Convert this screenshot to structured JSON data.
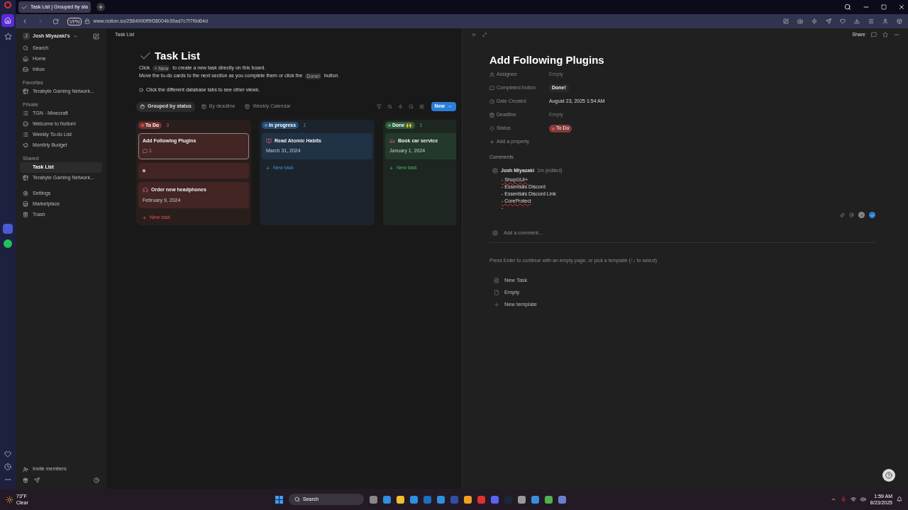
{
  "browser": {
    "tab_title": "Task List | Grouped by sta",
    "url": "www.notion.so/2584990ff9f38004b39ad7c7f7f9d64d",
    "vpn": "VPN"
  },
  "sidebar": {
    "workspace": "Josh Miyazaki's",
    "workspace_initial": "J",
    "top_items": [
      {
        "label": "Search"
      },
      {
        "label": "Home"
      },
      {
        "label": "Inbox"
      }
    ],
    "sections": [
      {
        "title": "Favorites",
        "items": [
          {
            "label": "Terabyte Gaming Network...",
            "selected": false
          }
        ]
      },
      {
        "title": "Private",
        "items": [
          {
            "label": "TGN - Minecraft",
            "selected": false
          },
          {
            "label": "Welcome to Notion!",
            "selected": false
          },
          {
            "label": "Weekly To-do List",
            "selected": false
          },
          {
            "label": "Monthly Budget",
            "selected": false
          }
        ]
      },
      {
        "title": "Shared",
        "items": [
          {
            "label": "Task List",
            "selected": true
          },
          {
            "label": "Terabyte Gaming Network...",
            "selected": false
          }
        ]
      }
    ],
    "bottom_items": [
      {
        "label": "Settings"
      },
      {
        "label": "Marketplace"
      },
      {
        "label": "Trash"
      }
    ],
    "invite": "Invite members"
  },
  "page": {
    "breadcrumb": "Task List",
    "title": "Task List",
    "desc_line_1": {
      "before": "Click",
      "chip": "+ New",
      "after": "to create a new task directly on this board."
    },
    "desc_line_2": {
      "before": "Move the to-do cards to the next section as you complete them or click the",
      "chip": "Done!",
      "after": "button."
    },
    "desc_line_3": "Click the different database tabs to see other views.",
    "views": [
      {
        "label": "Grouped by status",
        "selected": true
      },
      {
        "label": "By deadline",
        "selected": false
      },
      {
        "label": "Weekly Calendar",
        "selected": false
      }
    ],
    "new_button": "New",
    "columns": [
      {
        "name": "To Do",
        "count": "3",
        "color": "#d9534f",
        "add_label": "New task",
        "cards": [
          {
            "title": "Add Following Plugins",
            "comments": "1",
            "selected": true
          },
          {
            "title": "a",
            "selected": false
          },
          {
            "title": "Order new headphones",
            "date": "February 9, 2024",
            "selected": false
          }
        ]
      },
      {
        "name": "In progress",
        "count": "1",
        "color": "#3d8ee0",
        "add_label": "New task",
        "cards": [
          {
            "title": "Read Atomic Habits",
            "date": "March 31, 2024",
            "selected": false
          }
        ]
      },
      {
        "name": "Done 🙌",
        "count": "1",
        "color": "#4dab6e",
        "add_label": "New task",
        "cards": [
          {
            "title": "Book car service",
            "date": "January 1, 2024",
            "selected": false
          }
        ]
      }
    ]
  },
  "peek": {
    "share": "Share",
    "title": "Add Following Plugins",
    "properties": [
      {
        "label": "Assignee",
        "kind": "empty",
        "value": "Empty"
      },
      {
        "label": "Completed button",
        "kind": "button",
        "value": "Done!"
      },
      {
        "label": "Date Created",
        "kind": "text",
        "value": "August 23, 2025 1:54 AM"
      },
      {
        "label": "Deadline",
        "kind": "empty",
        "value": "Empty"
      },
      {
        "label": "Status",
        "kind": "status",
        "value": "To Do",
        "color": "#d9534f"
      }
    ],
    "add_property": "Add a property",
    "comments_title": "Comments",
    "comment": {
      "author": "Josh Miyazaki",
      "meta": "1m (edited)",
      "lines": [
        {
          "text": "- ShopGUI+",
          "misspelled": true
        },
        {
          "text": "- Essentials Discord",
          "misspelled": false
        },
        {
          "text": "- Essentials Discord Link",
          "misspelled": false
        },
        {
          "text": "- CoreProtect",
          "misspelled": true
        },
        {
          "text": "-",
          "misspelled": false
        }
      ]
    },
    "add_comment_placeholder": "Add a comment...",
    "template_hint": "Press Enter to continue with an empty page, or pick a template (↑↓ to select)",
    "templates": [
      {
        "label": "New Task",
        "kind": "page"
      },
      {
        "label": "Empty",
        "kind": "page"
      },
      {
        "label": "New template",
        "kind": "add"
      }
    ]
  },
  "taskbar": {
    "temperature": "73°F",
    "weather": "Clear",
    "search": "Search",
    "time": "1:59 AM",
    "date": "8/23/2025"
  }
}
